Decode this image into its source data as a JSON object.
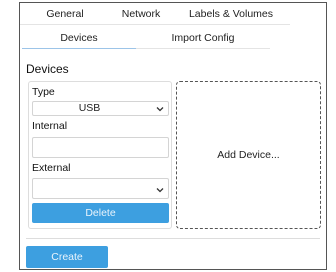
{
  "tabs_row1": [
    {
      "label": "General"
    },
    {
      "label": "Network"
    },
    {
      "label": "Labels & Volumes"
    }
  ],
  "tabs_row2": [
    {
      "label": "Devices",
      "active": true
    },
    {
      "label": "Import Config",
      "active": false
    }
  ],
  "section_title": "Devices",
  "device": {
    "type_label": "Type",
    "type_value": "USB",
    "internal_label": "Internal",
    "internal_value": "",
    "external_label": "External",
    "external_value": "",
    "delete_label": "Delete"
  },
  "add_device_label": "Add Device...",
  "create_label": "Create",
  "colors": {
    "accent": "#3d9fe0",
    "active_tab_underline": "#9cc4e8",
    "button_text": "#eaf4fc"
  },
  "icons": {
    "select_chevron": "chevron-down-icon"
  }
}
